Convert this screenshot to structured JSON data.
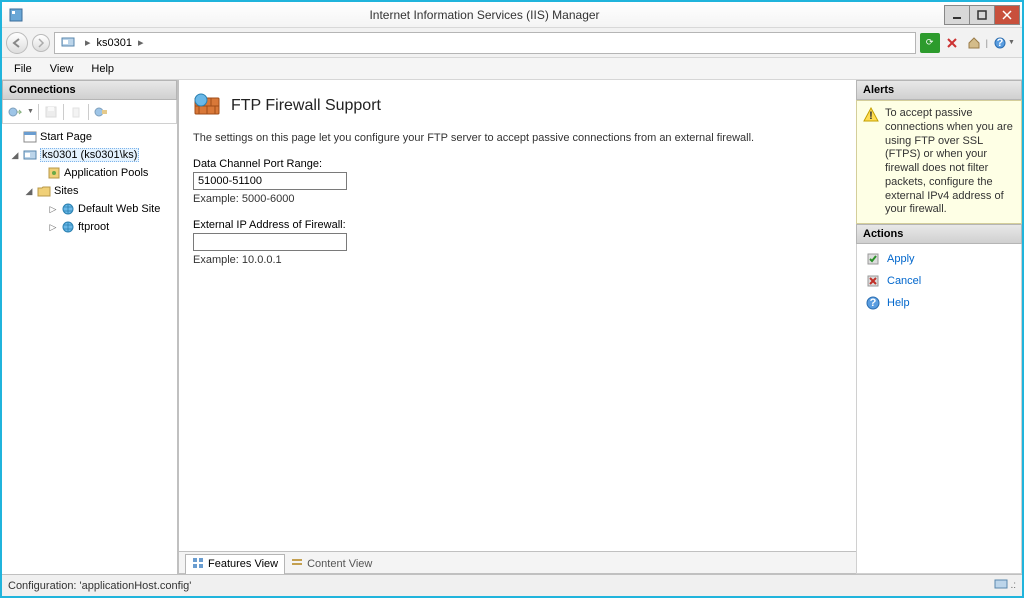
{
  "titlebar": {
    "title": "Internet Information Services (IIS) Manager"
  },
  "breadcrumb": {
    "host": "ks0301"
  },
  "menu": {
    "file": "File",
    "view": "View",
    "help": "Help"
  },
  "connections": {
    "header": "Connections",
    "startPage": "Start Page",
    "serverNode": "ks0301 (ks0301\\ks)",
    "appPools": "Application Pools",
    "sites": "Sites",
    "defaultSite": "Default Web Site",
    "ftproot": "ftproot"
  },
  "feature": {
    "title": "FTP Firewall Support",
    "description": "The settings on this page let you configure your FTP server to accept passive connections from an external firewall.",
    "portLabel": "Data Channel Port Range:",
    "portValue": "51000-51100",
    "portExample": "Example: 5000-6000",
    "extIpLabel": "External IP Address of Firewall:",
    "extIpValue": "",
    "extIpExample": "Example: 10.0.0.1"
  },
  "tabs": {
    "features": "Features View",
    "content": "Content View"
  },
  "alerts": {
    "header": "Alerts",
    "text": "To accept passive connections when you are using FTP over SSL (FTPS) or when your firewall does not filter packets, configure the external IPv4 address of your firewall."
  },
  "actions": {
    "header": "Actions",
    "apply": "Apply",
    "cancel": "Cancel",
    "help": "Help"
  },
  "status": {
    "config": "Configuration: 'applicationHost.config'"
  }
}
